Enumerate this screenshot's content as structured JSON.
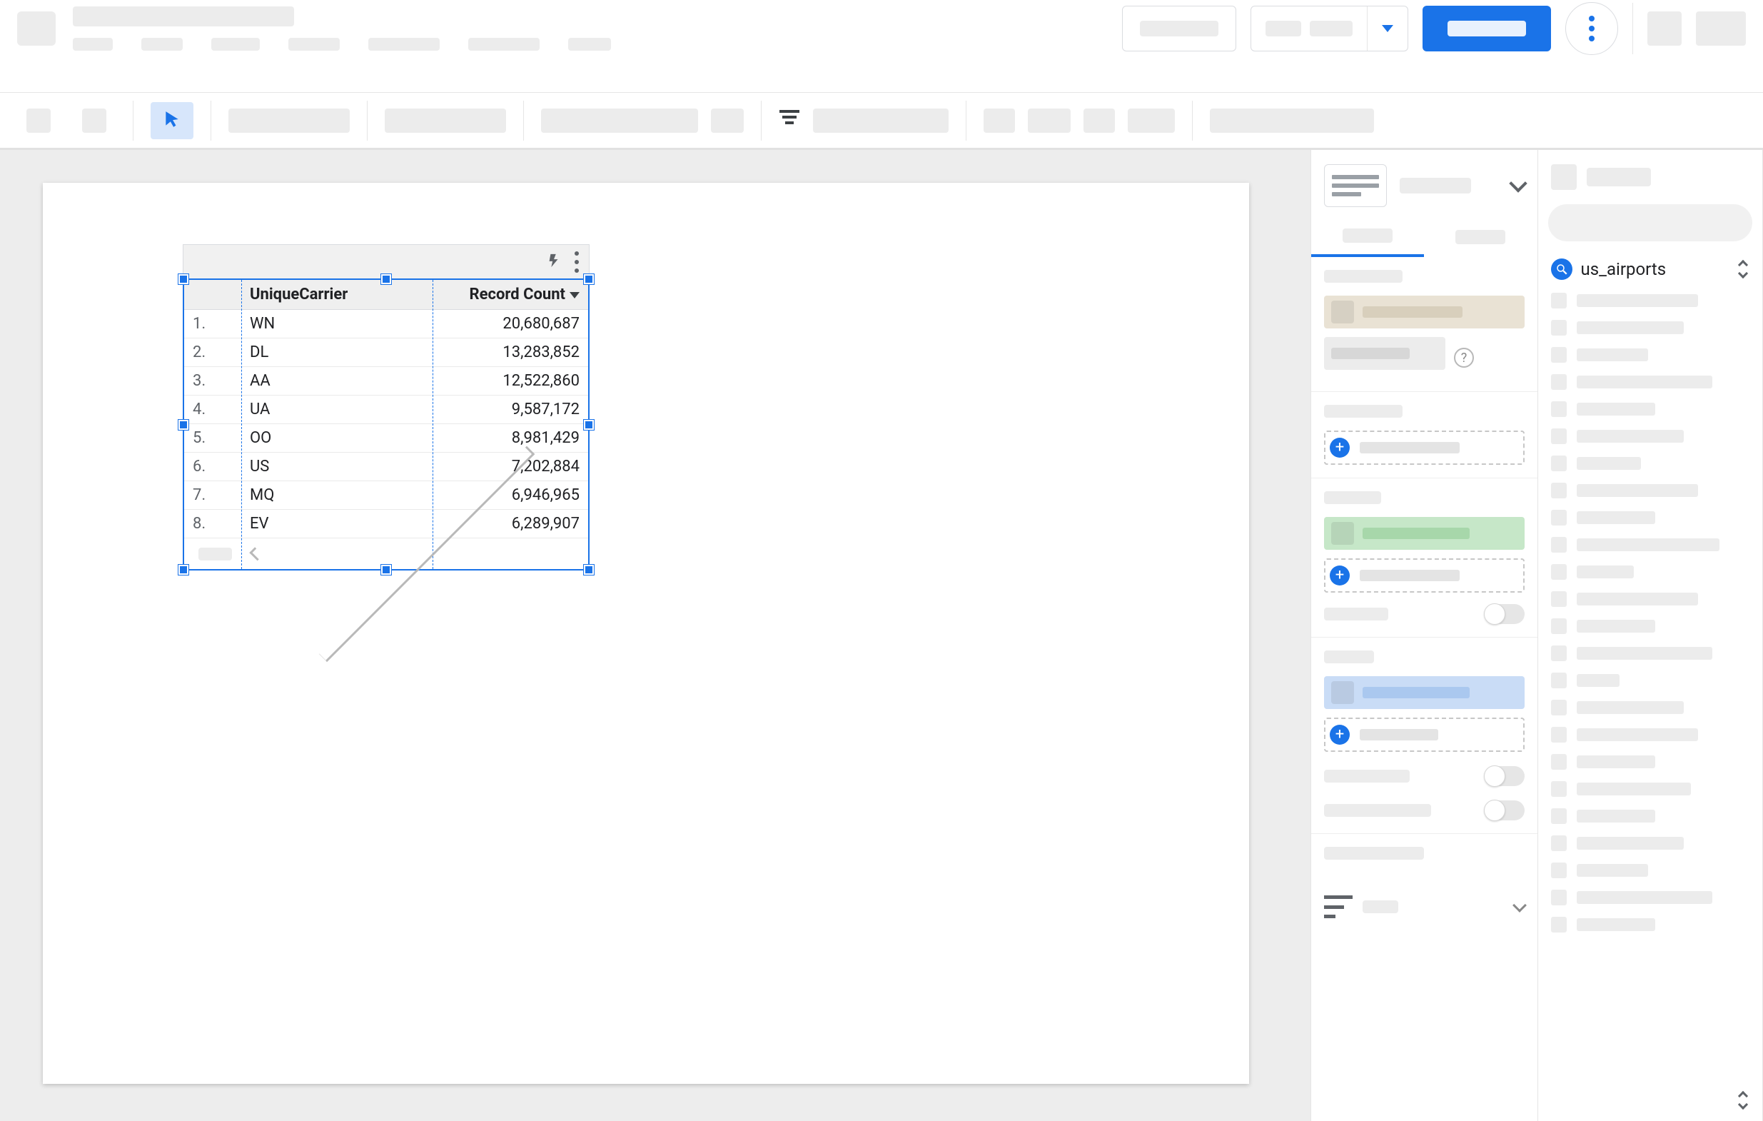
{
  "data_source": {
    "name": "us_airports"
  },
  "table_chart": {
    "dimension_header": "UniqueCarrier",
    "metric_header": "Record Count",
    "rows": [
      {
        "idx": "1.",
        "carrier": "WN",
        "count": "20,680,687"
      },
      {
        "idx": "2.",
        "carrier": "DL",
        "count": "13,283,852"
      },
      {
        "idx": "3.",
        "carrier": "AA",
        "count": "12,522,860"
      },
      {
        "idx": "4.",
        "carrier": "UA",
        "count": "9,587,172"
      },
      {
        "idx": "5.",
        "carrier": "OO",
        "count": "8,981,429"
      },
      {
        "idx": "6.",
        "carrier": "US",
        "count": "7,202,884"
      },
      {
        "idx": "7.",
        "carrier": "MQ",
        "count": "6,946,965"
      },
      {
        "idx": "8.",
        "carrier": "EV",
        "count": "6,289,907"
      }
    ]
  },
  "chart_data": {
    "type": "table",
    "columns": [
      "UniqueCarrier",
      "Record Count"
    ],
    "rows": [
      [
        "WN",
        20680687
      ],
      [
        "DL",
        13283852
      ],
      [
        "AA",
        12522860
      ],
      [
        "UA",
        9587172
      ],
      [
        "OO",
        8981429
      ],
      [
        "US",
        7202884
      ],
      [
        "MQ",
        6946965
      ],
      [
        "EV",
        6289907
      ]
    ],
    "sort": {
      "column": "Record Count",
      "direction": "desc"
    }
  }
}
